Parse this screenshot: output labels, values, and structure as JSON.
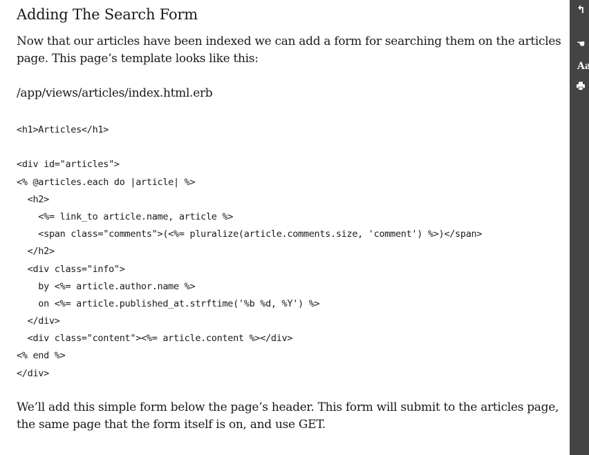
{
  "article": {
    "title": "Adding The Search Form",
    "intro": "Now that our articles have been indexed we can add a form for searching them on the articles page. This page’s template looks like this:",
    "file_path": "/app/views/articles/index.html.erb",
    "code_lines": [
      "<h1>Articles</h1>",
      "",
      "<div id=\"articles\">",
      "<% @articles.each do |article| %>",
      "  <h2>",
      "    <%= link_to article.name, article %>",
      "    <span class=\"comments\">(<%= pluralize(article.comments.size, 'comment') %>)</span>",
      "  </h2>",
      "  <div class=\"info\">",
      "    by <%= article.author.name %>",
      "    on <%= article.published_at.strftime('%b %d, %Y') %>",
      "  </div>",
      "  <div class=\"content\"><%= article.content %></div>",
      "<% end %>",
      "</div>"
    ],
    "outro": "We’ll add this simple form below the page’s header. This form will submit to the articles page, the same page that the form itself is on, and use GET."
  },
  "sidebar": {
    "back_glyph": "↰",
    "hand_glyph": "☚",
    "font_size_label": "Aa",
    "icon_color": "#ffffff",
    "background": "#444444"
  }
}
